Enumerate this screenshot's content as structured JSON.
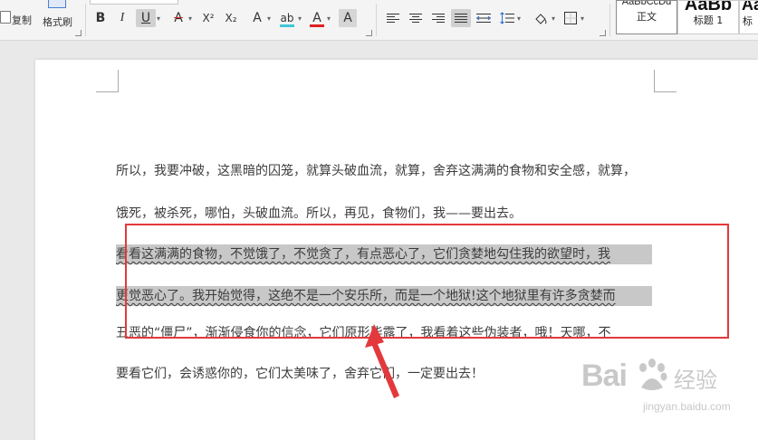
{
  "toolbar": {
    "clipboard": {
      "copy_label": "复制",
      "format_painter_label": "格式刷"
    },
    "font": {
      "bold_glyph": "B",
      "italic_glyph": "I",
      "underline_glyph": "U",
      "strikethrough_glyph": "A",
      "superscript_glyph": "X²",
      "subscript_glyph": "X₂",
      "text_effect_glyph": "A",
      "highlight_glyph": "ab",
      "font_color_glyph": "A",
      "char_shading_glyph": "A"
    },
    "styles": [
      {
        "preview": "AaBbCcDd",
        "name": "正文"
      },
      {
        "preview": "AaBb",
        "name": "标题 1"
      },
      {
        "preview": "Aa",
        "name": "标"
      }
    ]
  },
  "document": {
    "lines": [
      "所以，我要冲破，这黑暗的囚笼，就算头破血流，就算，舍弃这满满的食物和安全感，就算，",
      "饿死，被杀死，哪怕，头破血流。所以，再见，食物们，我——要出去。",
      " 看看这满满的食物，不觉饿了，不觉贪了，有点恶心了，它们贪婪地勾住我的欲望时，我",
      "更觉恶心了。我开始觉得，这绝不是一个安乐所，而是一个地狱!这个地狱里有许多贪婪而",
      "丑恶的“僵尸”，渐渐侵食你的信念，它们原形毕露了，我看着这些伪装者，哦！天哪，不",
      "要看它们，会诱惑你的，它们太美味了，舍弃它们，一定要出去！"
    ]
  },
  "watermark": {
    "brand": "Bai",
    "brand_cn": "经验",
    "url": "jingyan.baidu.com"
  },
  "colors": {
    "highlight_bar": "#3fc7d8",
    "font_color_bar": "#e02020",
    "strike_color": "#e02020",
    "annotation_red": "#e3393c",
    "selection": "#c8c8c8"
  }
}
